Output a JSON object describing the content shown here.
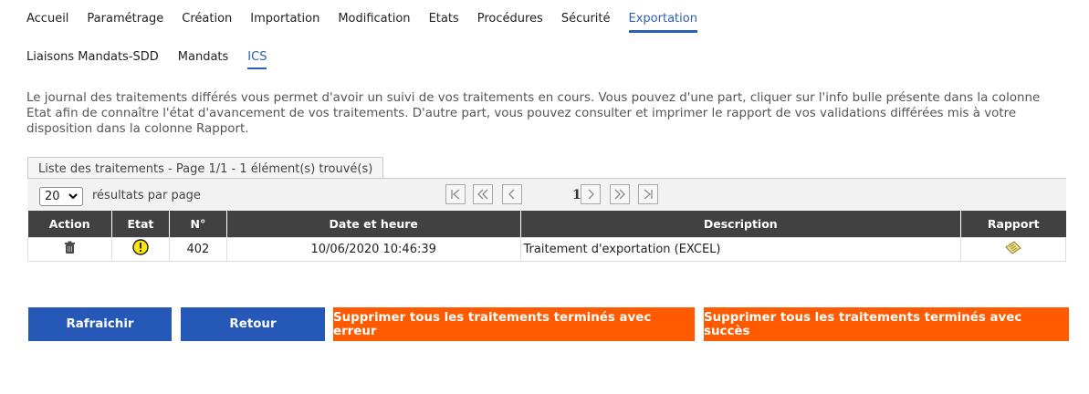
{
  "top_nav": [
    {
      "label": "Accueil"
    },
    {
      "label": "Paramétrage"
    },
    {
      "label": "Création"
    },
    {
      "label": "Importation"
    },
    {
      "label": "Modification"
    },
    {
      "label": "Etats"
    },
    {
      "label": "Procédures"
    },
    {
      "label": "Sécurité"
    },
    {
      "label": "Exportation",
      "active": true
    }
  ],
  "sub_nav": [
    {
      "label": "Liaisons Mandats-SDD"
    },
    {
      "label": "Mandats"
    },
    {
      "label": "ICS",
      "active": true
    }
  ],
  "intro_text": "Le journal des traitements différés vous permet d'avoir un suivi de vos traitements en cours. Vous pouvez d'une part, cliquer sur l'info bulle présente dans la colonne Etat afin de connaître l'état d'avancement de vos traitements. D'autre part, vous pouvez consulter et imprimer le rapport de vos validations différées mis à votre disposition dans la colonne Rapport.",
  "list": {
    "tab_title": "Liste des traitements - Page 1/1 - 1 élément(s) trouvé(s)",
    "per_page_value": "20",
    "per_page_label": "résultats par page",
    "current_page": "1",
    "columns": {
      "action": "Action",
      "etat": "Etat",
      "numero": "N°",
      "date": "Date et heure",
      "description": "Description",
      "rapport": "Rapport"
    },
    "rows": [
      {
        "action_icon": "trash-icon",
        "etat_icon": "warning-icon",
        "numero": "402",
        "date": "10/06/2020 10:46:39",
        "description": "Traitement d'exportation (EXCEL)",
        "rapport_icon": "report-icon"
      }
    ]
  },
  "buttons": {
    "refresh": "Rafraichir",
    "back": "Retour",
    "delete_error": "Supprimer tous les traitements terminés avec erreur",
    "delete_success": "Supprimer tous les traitements terminés avec succès"
  },
  "colors": {
    "accent_blue": "#2b5fb8",
    "button_blue": "#2658b8",
    "button_orange": "#ff5a00",
    "header_dark": "#414141"
  }
}
